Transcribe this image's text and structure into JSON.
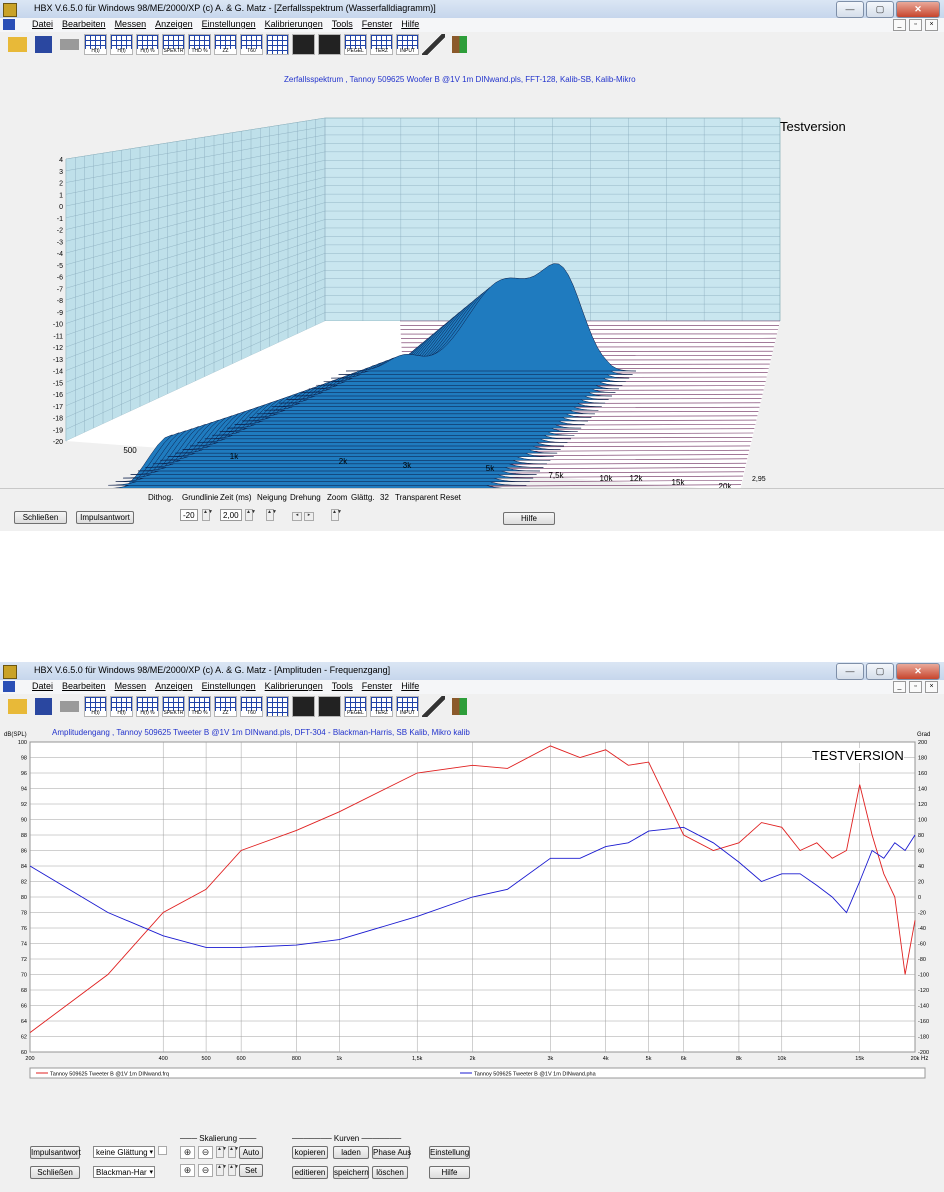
{
  "window1": {
    "title": "HBX V.6.5.0   für Windows 98/ME/2000/XP    (c)  A. & G. Matz - [Zerfallsspektrum (Wasserfalldiagramm)]",
    "menu": [
      "Datei",
      "Bearbeiten",
      "Messen",
      "Anzeigen",
      "Einstellungen",
      "Kalibrierungen",
      "Tools",
      "Fenster",
      "Hilfe"
    ],
    "toolbar": [
      "",
      "",
      "",
      "H(t)",
      "H(f)",
      "H(f) %",
      "SPEKTR",
      "THD %",
      "ZZ",
      "T60",
      "",
      "",
      "",
      "PEGEL",
      "TERZ",
      "INPUT",
      "",
      ""
    ],
    "chart_title": "Zerfallsspektrum , Tannoy 509625 Woofer B @1V 1m DINwand.pls, FFT-128, Kalib-SB, Kalib-Mikro",
    "watermark": "Testversion",
    "chart_data": {
      "type": "area",
      "title": "Zerfallsspektrum , Tannoy 509625 Woofer B @1V 1m DINwand.pls, FFT-128, Kalib-SB, Kalib-Mikro",
      "y_ticks": [
        "4",
        "3",
        "2",
        "1",
        "0",
        "-1",
        "-2",
        "-3",
        "-4",
        "-5",
        "-6",
        "-7",
        "-8",
        "-9",
        "-10",
        "-11",
        "-12",
        "-13",
        "-14",
        "-15",
        "-16",
        "-17",
        "-18",
        "-19",
        "-20"
      ],
      "x_ticks": [
        "500",
        "1k",
        "2k",
        "3k",
        "5k",
        "7,5k",
        "10k",
        "12k",
        "15k",
        "20k"
      ],
      "ylim": [
        -20,
        4
      ],
      "z_label": "2,95"
    },
    "controls": {
      "close": "Schließen",
      "impulse": "Impulsantwort",
      "labels": [
        "Dithog.",
        "Grundlinie",
        "Zeit (ms)",
        "Neigung",
        "Drehung",
        "Zoom",
        "Glättg.",
        "32",
        "Transparent",
        "Reset"
      ],
      "grundlinie": "-20",
      "zeit": "2,00",
      "help": "Hilfe"
    }
  },
  "window2": {
    "title": "HBX V.6.5.0   für Windows 98/ME/2000/XP    (c)  A. & G. Matz - [Amplituden - Frequenzgang]",
    "menu": [
      "Datei",
      "Bearbeiten",
      "Messen",
      "Anzeigen",
      "Einstellungen",
      "Kalibrierungen",
      "Tools",
      "Fenster",
      "Hilfe"
    ],
    "chart_title": "Amplitudengang , Tannoy 509625 Tweeter B @1V 1m DINwand.pls, DFT-304 - Blackman-Harris, SB Kalib, Mikro kalib",
    "watermark": "TESTVERSION",
    "chart_data": {
      "type": "line",
      "title": "Amplitudengang , Tannoy 509625 Tweeter B @1V 1m DINwand.pls, DFT-304 - Blackman-Harris, SB Kalib, Mikro kalib",
      "ylabel": "dB(SPL)",
      "y2label": "Grad",
      "xunit": "Hz",
      "ylim": [
        60,
        100
      ],
      "y2lim": [
        -200,
        200
      ],
      "xlim": [
        200,
        20000
      ],
      "x_scale": "log",
      "y_ticks": [
        "100",
        "98",
        "96",
        "94",
        "92",
        "90",
        "88",
        "86",
        "84",
        "82",
        "80",
        "78",
        "76",
        "74",
        "72",
        "70",
        "68",
        "66",
        "64",
        "62",
        "60"
      ],
      "y2_ticks": [
        "200",
        "180",
        "160",
        "140",
        "120",
        "100",
        "80",
        "60",
        "40",
        "20",
        "0",
        "-20",
        "-40",
        "-60",
        "-80",
        "-100",
        "-120",
        "-140",
        "-160",
        "-180",
        "-200"
      ],
      "x_ticks": [
        "200",
        "400",
        "500",
        "600",
        "800",
        "1k",
        "1,5k",
        "2k",
        "3k",
        "4k",
        "5k",
        "6k",
        "8k",
        "10k",
        "15k",
        "20k"
      ],
      "series": [
        {
          "name": "Tannoy 509625 Tweeter B @1V 1m DINwand.frq",
          "color": "#e02020",
          "x": [
            200,
            300,
            400,
            500,
            600,
            800,
            1000,
            1500,
            2000,
            2400,
            3000,
            3500,
            4000,
            4500,
            5000,
            6000,
            7000,
            8000,
            9000,
            10000,
            11000,
            12000,
            13000,
            14000,
            15000,
            16000,
            17000,
            18000,
            19000,
            20000
          ],
          "y": [
            62.5,
            70,
            78,
            81,
            86,
            88.6,
            91,
            96,
            97,
            96.6,
            99.5,
            98,
            99,
            97,
            97.4,
            88,
            86,
            87,
            89.6,
            89,
            86,
            87,
            85,
            86,
            94.5,
            88,
            83,
            80,
            70,
            77
          ]
        },
        {
          "name": "Tannoy 509625 Tweeter B @1V 1m DINwand.pha",
          "color": "#1a1ad0",
          "x": [
            200,
            300,
            400,
            500,
            600,
            800,
            1000,
            1500,
            2000,
            2400,
            3000,
            3500,
            4000,
            4500,
            5000,
            6000,
            7000,
            8000,
            9000,
            10000,
            11000,
            12000,
            13000,
            14000,
            15000,
            16000,
            17000,
            18000,
            19000,
            20000
          ],
          "y": [
            40,
            -20,
            -50,
            -65,
            -65,
            -62,
            -55,
            -25,
            0,
            10,
            50,
            50,
            65,
            70,
            85,
            90,
            70,
            45,
            20,
            30,
            30,
            15,
            0,
            -20,
            20,
            60,
            50,
            70,
            60,
            80
          ]
        }
      ]
    },
    "legend": [
      "Tannoy 509625 Tweeter B @1V 1m DINwand.frq",
      "Tannoy 509625 Tweeter B @1V 1m DINwand.pha"
    ],
    "controls": {
      "impulse": "Impulsantwort",
      "close": "Schließen",
      "smoothing": "keine Glättung",
      "window": "Blackman-Har",
      "skalierung": "Skalierung",
      "auto": "Auto",
      "set": "Set",
      "kurven": "Kurven",
      "kopieren": "kopieren",
      "laden": "laden",
      "phase": "Phase Aus",
      "editieren": "editieren",
      "speichern": "speichern",
      "loeschen": "löschen",
      "einstellung": "Einstellung",
      "hilfe": "Hilfe"
    }
  }
}
